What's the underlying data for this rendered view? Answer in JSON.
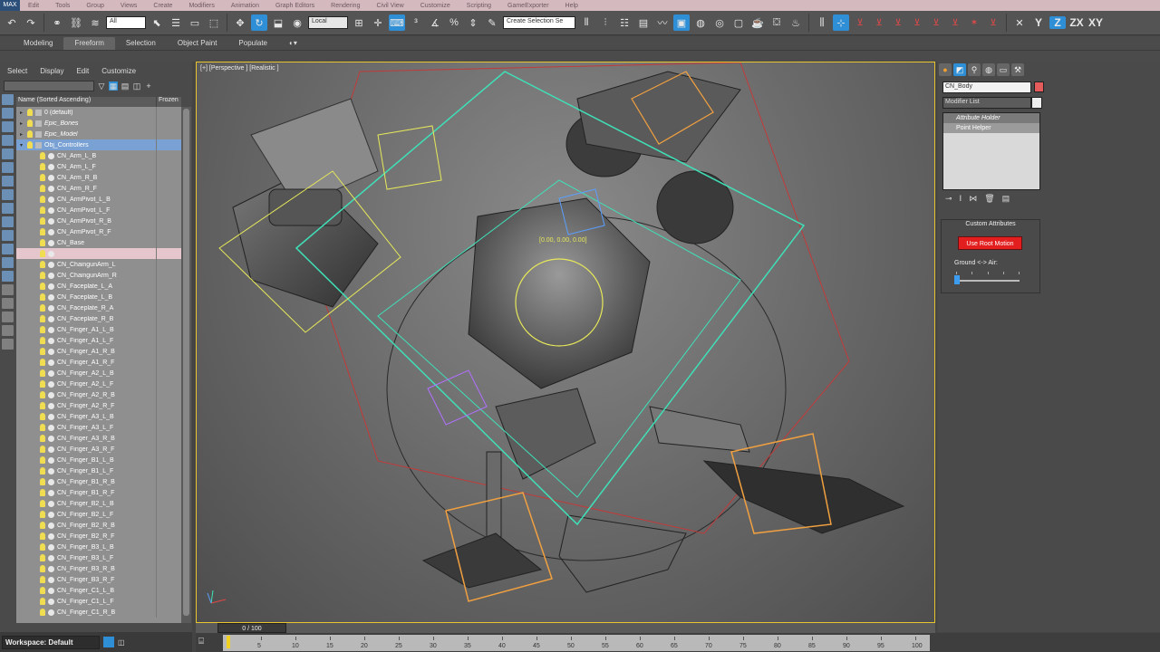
{
  "menubar": {
    "logo": "MAX",
    "items": [
      "Edit",
      "Tools",
      "Group",
      "Views",
      "Create",
      "Modifiers",
      "Animation",
      "Graph Editors",
      "Rendering",
      "Civil View",
      "Customize",
      "Scripting",
      "GameExporter",
      "Help"
    ]
  },
  "toolbar": {
    "selection_filter": "All",
    "ref_coord": "Local",
    "named_selection": "Create Selection Se",
    "axis_x": "X",
    "axis_y": "Y",
    "axis_z": "Z",
    "axis_zx": "ZX",
    "axis_xy": "XY"
  },
  "ribbon": {
    "tabs": [
      "Modeling",
      "Freeform",
      "Selection",
      "Object Paint",
      "Populate"
    ],
    "active_tab": "Freeform"
  },
  "explorer": {
    "menu": [
      "Select",
      "Display",
      "Edit",
      "Customize"
    ],
    "col_name": "Name (Sorted Ascending)",
    "col_frozen": "Frozen",
    "rows": [
      {
        "name": "0 (default)",
        "type": "layer",
        "state": ""
      },
      {
        "name": "Epic_Bones",
        "type": "layer",
        "state": ""
      },
      {
        "name": "Epic_Model",
        "type": "layer",
        "state": ""
      },
      {
        "name": "Obj_Controllers",
        "type": "layer",
        "state": "selected"
      },
      {
        "name": "CN_Arm_L_B",
        "type": "node",
        "state": ""
      },
      {
        "name": "CN_Arm_L_F",
        "type": "node",
        "state": ""
      },
      {
        "name": "CN_Arm_R_B",
        "type": "node",
        "state": ""
      },
      {
        "name": "CN_Arm_R_F",
        "type": "node",
        "state": ""
      },
      {
        "name": "CN_ArmPivot_L_B",
        "type": "node",
        "state": ""
      },
      {
        "name": "CN_ArmPivot_L_F",
        "type": "node",
        "state": ""
      },
      {
        "name": "CN_ArmPivot_R_B",
        "type": "node",
        "state": ""
      },
      {
        "name": "CN_ArmPivot_R_F",
        "type": "node",
        "state": ""
      },
      {
        "name": "CN_Base",
        "type": "node",
        "state": ""
      },
      {
        "name": "",
        "type": "node",
        "state": "highlight"
      },
      {
        "name": "CN_ChaingunArm_L",
        "type": "node",
        "state": ""
      },
      {
        "name": "CN_ChaingunArm_R",
        "type": "node",
        "state": ""
      },
      {
        "name": "CN_Faceplate_L_A",
        "type": "node",
        "state": ""
      },
      {
        "name": "CN_Faceplate_L_B",
        "type": "node",
        "state": ""
      },
      {
        "name": "CN_Faceplate_R_A",
        "type": "node",
        "state": ""
      },
      {
        "name": "CN_Faceplate_R_B",
        "type": "node",
        "state": ""
      },
      {
        "name": "CN_Finger_A1_L_B",
        "type": "node",
        "state": ""
      },
      {
        "name": "CN_Finger_A1_L_F",
        "type": "node",
        "state": ""
      },
      {
        "name": "CN_Finger_A1_R_B",
        "type": "node",
        "state": ""
      },
      {
        "name": "CN_Finger_A1_R_F",
        "type": "node",
        "state": ""
      },
      {
        "name": "CN_Finger_A2_L_B",
        "type": "node",
        "state": ""
      },
      {
        "name": "CN_Finger_A2_L_F",
        "type": "node",
        "state": ""
      },
      {
        "name": "CN_Finger_A2_R_B",
        "type": "node",
        "state": ""
      },
      {
        "name": "CN_Finger_A2_R_F",
        "type": "node",
        "state": ""
      },
      {
        "name": "CN_Finger_A3_L_B",
        "type": "node",
        "state": ""
      },
      {
        "name": "CN_Finger_A3_L_F",
        "type": "node",
        "state": ""
      },
      {
        "name": "CN_Finger_A3_R_B",
        "type": "node",
        "state": ""
      },
      {
        "name": "CN_Finger_A3_R_F",
        "type": "node",
        "state": ""
      },
      {
        "name": "CN_Finger_B1_L_B",
        "type": "node",
        "state": ""
      },
      {
        "name": "CN_Finger_B1_L_F",
        "type": "node",
        "state": ""
      },
      {
        "name": "CN_Finger_B1_R_B",
        "type": "node",
        "state": ""
      },
      {
        "name": "CN_Finger_B1_R_F",
        "type": "node",
        "state": ""
      },
      {
        "name": "CN_Finger_B2_L_B",
        "type": "node",
        "state": ""
      },
      {
        "name": "CN_Finger_B2_L_F",
        "type": "node",
        "state": ""
      },
      {
        "name": "CN_Finger_B2_R_B",
        "type": "node",
        "state": ""
      },
      {
        "name": "CN_Finger_B2_R_F",
        "type": "node",
        "state": ""
      },
      {
        "name": "CN_Finger_B3_L_B",
        "type": "node",
        "state": ""
      },
      {
        "name": "CN_Finger_B3_L_F",
        "type": "node",
        "state": ""
      },
      {
        "name": "CN_Finger_B3_R_B",
        "type": "node",
        "state": ""
      },
      {
        "name": "CN_Finger_B3_R_F",
        "type": "node",
        "state": ""
      },
      {
        "name": "CN_Finger_C1_L_B",
        "type": "node",
        "state": ""
      },
      {
        "name": "CN_Finger_C1_L_F",
        "type": "node",
        "state": ""
      },
      {
        "name": "CN_Finger_C1_R_B",
        "type": "node",
        "state": ""
      }
    ]
  },
  "workspace": {
    "label": "Workspace: Default"
  },
  "viewport": {
    "label": "[+] [Perspective ] [Realistic ]",
    "readout": "[0.00, 0.00, 0.00]"
  },
  "command_panel": {
    "object_name": "CN_Body",
    "object_color": "#e35b5b",
    "modifier_list": "Modifier List",
    "stack": [
      "Attribute Holder",
      "Point Helper"
    ],
    "custom_attributes_title": "Custom Attributes",
    "root_motion_button": "Use Root Motion",
    "ground_air_label": "Ground <-> Air:",
    "ground_air_value": 0
  },
  "timeline": {
    "frame_display": "0 / 100",
    "current_frame": 0,
    "ticks": [
      5,
      10,
      15,
      20,
      25,
      30,
      35,
      40,
      45,
      50,
      55,
      60,
      65,
      70,
      75,
      80,
      85,
      90,
      95,
      100
    ]
  },
  "colors": {
    "accent": "#2e8fd6",
    "selection_box": "#e8c42e",
    "root_motion_button": "#e21e1e",
    "controller_cyan": "#3fe0b8",
    "controller_yellow": "#e7e85a",
    "controller_orange": "#f0a040"
  }
}
